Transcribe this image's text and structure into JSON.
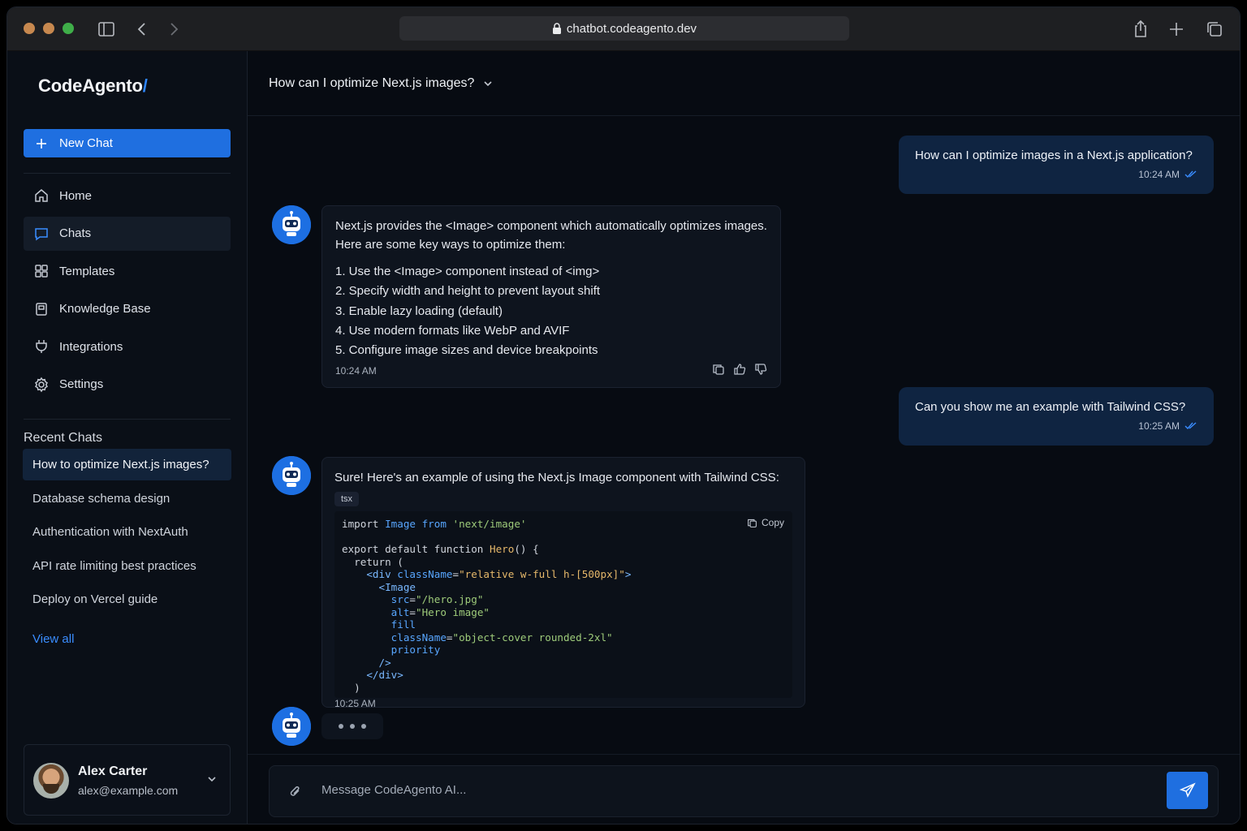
{
  "browser": {
    "url": "chatbot.codeagento.dev"
  },
  "sidebar": {
    "logo": "CodeAgento",
    "logo_mark": "/",
    "new_chat_label": "New Chat",
    "nav": [
      {
        "label": "Home",
        "icon": "home-icon"
      },
      {
        "label": "Chats",
        "icon": "chat-icon",
        "active": true
      },
      {
        "label": "Templates",
        "icon": "grid-icon"
      },
      {
        "label": "Knowledge Base",
        "icon": "book-icon"
      },
      {
        "label": "Integrations",
        "icon": "plug-icon"
      },
      {
        "label": "Settings",
        "icon": "gear-icon"
      }
    ],
    "recent_title": "Recent Chats",
    "recent": [
      "How to optimize Next.js images?",
      "Database schema design",
      "Authentication with NextAuth",
      "API rate limiting best practices",
      "Deploy on Vercel guide"
    ],
    "view_all": "View all",
    "user": {
      "name": "Alex Carter",
      "email": "alex@example.com"
    }
  },
  "main": {
    "title": "How can I optimize Next.js images?",
    "messages": {
      "u1": {
        "text": "How can I optimize images in a Next.js application?",
        "time": "10:24 AM"
      },
      "b1": {
        "intro": "Next.js provides the <Image> component which automatically optimizes images. Here are some key ways to optimize them:",
        "items": [
          "1. Use the <Image> component instead of <img>",
          "2. Specify width and height to prevent layout shift",
          "3. Enable lazy loading (default)",
          "4. Use modern formats like WebP and AVIF",
          "5. Configure image sizes and device breakpoints"
        ],
        "time": "10:24 AM"
      },
      "u2": {
        "text": "Can you show me an example with Tailwind CSS?",
        "time": "10:25 AM"
      },
      "b2": {
        "intro": "Sure! Here's an example of using the Next.js Image component with Tailwind CSS:",
        "lang": "tsx",
        "copy_label": "Copy",
        "code": {
          "l1a": "import ",
          "l1b": "Image",
          "l1c": " from ",
          "l1d": "'next/image'",
          "l3a": "export default function ",
          "l3b": "Hero",
          "l3c": "() {",
          "l4": "  return (",
          "l5a": "    <div ",
          "l5b": "className",
          "l5c": "=",
          "l5d": "\"relative w-full h-[500px]\"",
          "l5e": ">",
          "l6": "      <Image",
          "l7a": "        src",
          "l7b": "=",
          "l7c": "\"/hero.jpg\"",
          "l8a": "        alt",
          "l8b": "=",
          "l8c": "\"Hero image\"",
          "l9": "        fill",
          "l10a": "        className",
          "l10b": "=",
          "l10c": "\"object-cover rounded-2xl\"",
          "l11": "        priority",
          "l12": "      />",
          "l13": "    </div>",
          "l14": "  )"
        },
        "time": "10:25 AM"
      }
    },
    "composer": {
      "placeholder": "Message CodeAgento AI..."
    }
  },
  "colors": {
    "accent": "#1f6fe0",
    "user_bubble": "#0f2441",
    "background": "#070b12"
  }
}
